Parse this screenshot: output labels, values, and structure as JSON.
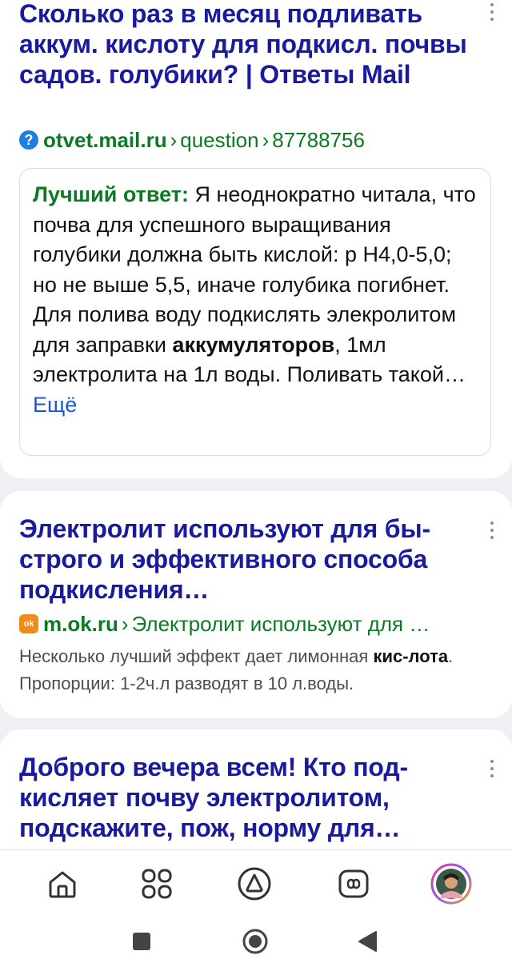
{
  "results": [
    {
      "title": "Сколько раз в месяц подливать аккум. кислоту для подкисл. почвы садов. голубики? | Ответы Mail",
      "source_host": "otvet.mail.ru",
      "source_path_1": "question",
      "source_path_2": "87788756",
      "answer_label": "Лучший ответ:",
      "answer_text_1": " Я неоднократно читала, что почва для успешного выращивания голубики должна быть кислой: р Н4,0-5,0; но не выше 5,5, иначе голубика погибнет. Для полива воду подкислять элекролитом для заправки ",
      "answer_bold": "аккумуляторов",
      "answer_text_2": ", 1мл электролита на 1л воды. Поливать такой…",
      "answer_more": " Ещё"
    },
    {
      "title": "Электролит используют для бы-строго и эффективного способа подкисления…",
      "source_host": "m.ok.ru",
      "source_path_1": "Электролит используют для …",
      "snippet_1": "Несколько лучший эффект дает лимонная ",
      "snippet_bold": "кис-лота",
      "snippet_2": ". Пропорции: 1-2ч.л разводят в 10 л.воды."
    },
    {
      "title": "Доброго вечера всем! Кто под-кисляет почву электролитом, подскажите, пож, норму для…"
    }
  ],
  "bottom_nav": {
    "icons": [
      "home-icon",
      "services-grid-icon",
      "alice-assistant-icon",
      "tabs-icon",
      "profile-avatar"
    ]
  },
  "system_nav": {
    "icons": [
      "recents-square-icon",
      "home-circle-icon",
      "back-triangle-icon"
    ]
  },
  "colors": {
    "title": "#1a1a9e",
    "source": "#0b7a22",
    "link_more": "#1a57d6",
    "background": "#eef0f3"
  }
}
